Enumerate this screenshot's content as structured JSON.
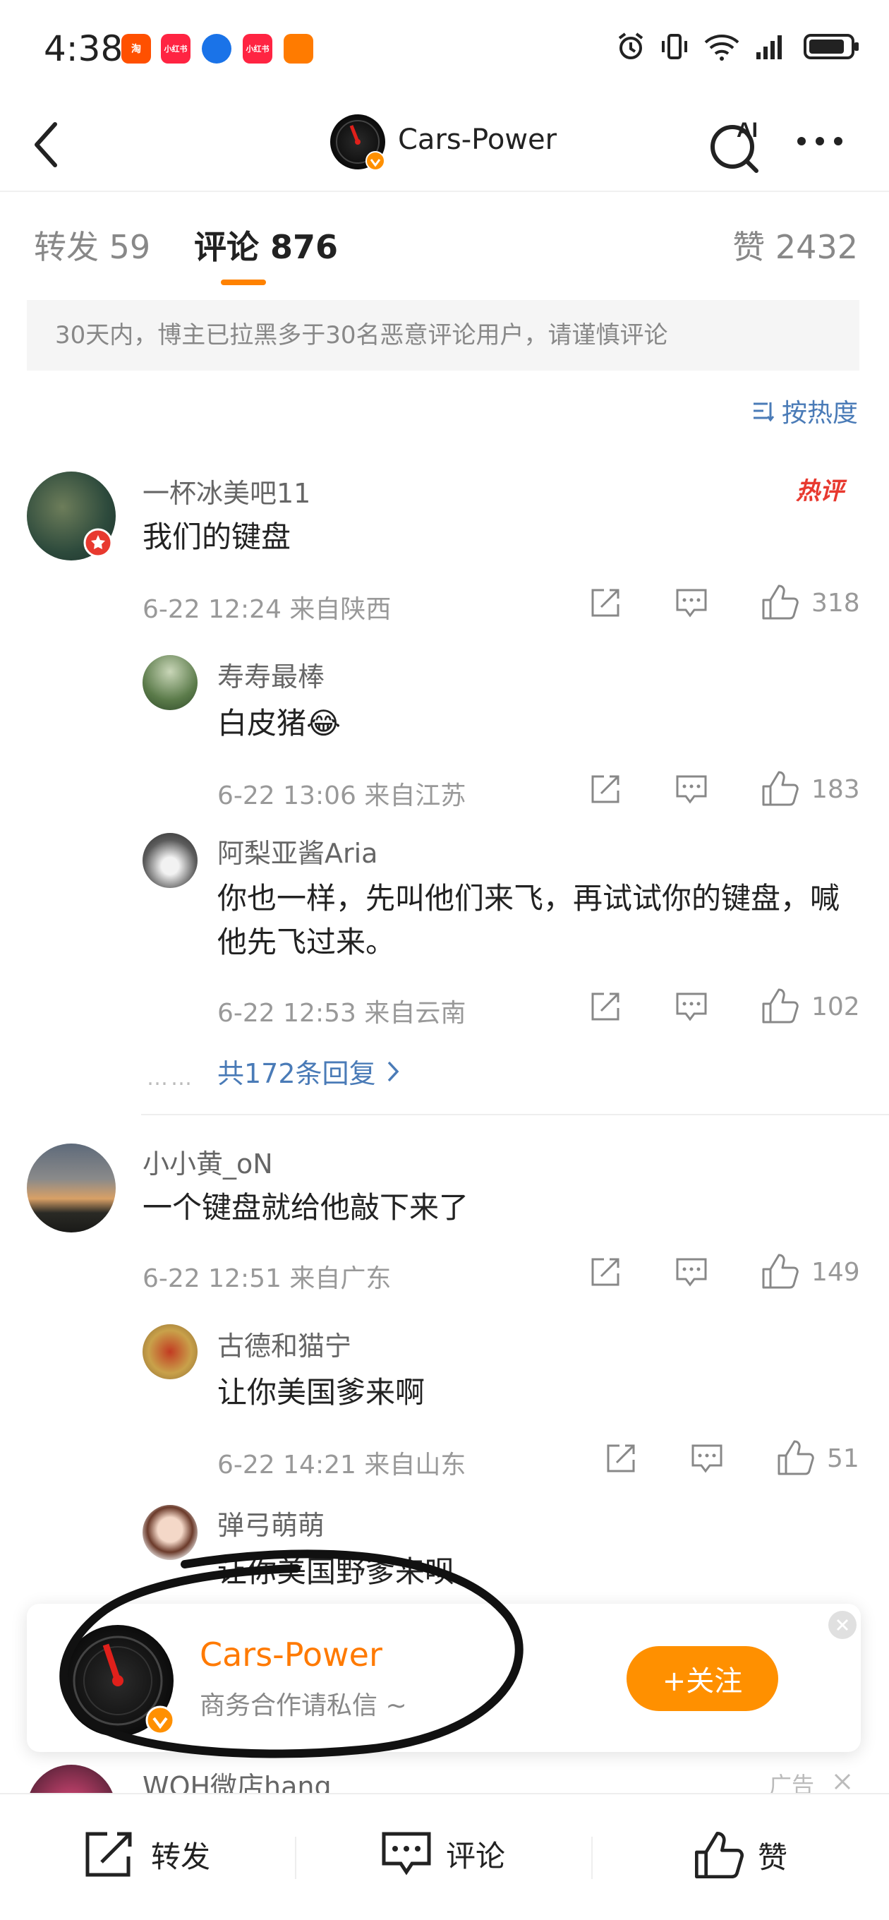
{
  "status_bar": {
    "time": "4:38",
    "app_badges": [
      {
        "label": "淘",
        "color": "#ff5000"
      },
      {
        "label": "小红书",
        "color": "#ff2442"
      },
      {
        "label": "",
        "color": "#1a73e8"
      },
      {
        "label": "小红书",
        "color": "#ff2442"
      },
      {
        "label": "",
        "color": "#ff7b00"
      }
    ],
    "battery_level": 0.85
  },
  "header": {
    "title": "Cars-Power"
  },
  "tabs": [
    {
      "label": "转发 59"
    },
    {
      "label": "评论 876"
    },
    {
      "label": "赞 2432"
    }
  ],
  "notice": "30天内，博主已拉黑多于30名恶意评论用户，请谨慎评论",
  "sort_label": "按热度",
  "comments": [
    {
      "username": "一杯冰美吧11",
      "text": "我们的键盘",
      "meta": "6-22 12:24  来自陕西",
      "likes": "318",
      "hot_badge": "热评",
      "replies": [
        {
          "username": "寿寿最棒",
          "text": "白皮猪😂",
          "meta": "6-22 13:06  来自江苏",
          "likes": "183"
        },
        {
          "username": "阿梨亚酱Aria",
          "text": "你也一样，先叫他们来飞，再试试你的键盘，喊他先飞过来。",
          "meta": "6-22 12:53  来自云南",
          "likes": "102"
        }
      ],
      "more_replies": "共172条回复"
    },
    {
      "username": "小小黄_oN",
      "text": "一个键盘就给他敲下来了",
      "meta": "6-22 12:51  来自广东",
      "likes": "149",
      "replies": [
        {
          "username": "古德和猫宁",
          "text": "让你美国爹来啊",
          "meta": "6-22 14:21  来自山东",
          "likes": "51"
        },
        {
          "username": "弹弓萌萌",
          "text": "让你美国野爹来呗"
        }
      ]
    }
  ],
  "partial_row": {
    "username": "WOH微店hang",
    "ad_label": "广告"
  },
  "card": {
    "name": "Cars-Power",
    "subtitle": "商务合作请私信 ~",
    "follow_label": "+关注"
  },
  "bottom_bar": {
    "repost": "转发",
    "comment": "评论",
    "like": "赞"
  }
}
